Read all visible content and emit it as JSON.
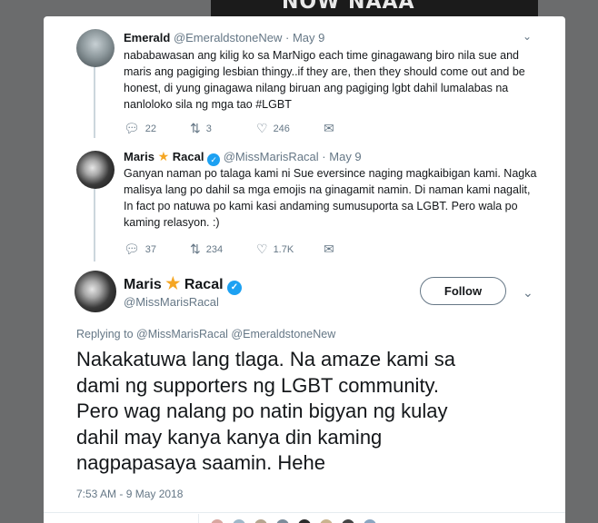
{
  "background_image": {
    "caption": "NOW NAAA"
  },
  "tweets": [
    {
      "name": "Emerald",
      "handle": "@EmeraldstoneNew",
      "separator": "·",
      "date": "May 9",
      "lines": [
        "nababawasan ang kilig ko sa MarNigo each time ginagawang biro nila sue and",
        "maris ang pagiging lesbian thingy..if they are, then they should come out and be",
        "honest, di yung ginagawa nilang biruan ang pagiging lgbt dahil lumalabas na",
        "nanloloko sila ng mga tao #LGBT"
      ],
      "actions": {
        "replies": "22",
        "retweets": "3",
        "likes": "246"
      }
    },
    {
      "name_first": "Maris",
      "name_last": "Racal",
      "handle": "@MissMarisRacal",
      "separator": "·",
      "date": "May 9",
      "lines": [
        "Ganyan naman po talaga kami ni Sue eversince naging magkaibigan kami. Nagka",
        "malisya lang po dahil sa mga emojis na ginagamit namin. Di naman kami nagalit,",
        "In fact po natuwa po kami kasi andaming sumusuporta sa LGBT. Pero wala po",
        "kaming relasyon. :)"
      ],
      "actions": {
        "replies": "37",
        "retweets": "234",
        "likes": "1.7K"
      }
    }
  ],
  "main_tweet": {
    "name_first": "Maris",
    "name_last": "Racal",
    "handle": "@MissMarisRacal",
    "follow_label": "Follow",
    "replying_label": "Replying to",
    "mention_1": "@MissMarisRacal",
    "mention_2": "@EmeraldstoneNew",
    "lines": [
      "Nakakatuwa lang tlaga. Na amaze kami sa",
      "dami ng supporters ng LGBT community.",
      "Pero wag nalang po natin bigyan ng kulay",
      "dahil may kanya kanya din kaming",
      "nagpapasaya saamin. Hehe"
    ],
    "timestamp": "7:53 AM - 9 May 2018"
  },
  "icons": {
    "reply": "reply-icon",
    "retweet": "retweet-icon",
    "like": "heart-icon",
    "dm": "envelope-icon",
    "verified": "verified-badge-icon",
    "caret": "chevron-down-icon"
  },
  "colors": {
    "accent": "#1da1f2",
    "star": "#f5a623",
    "muted": "#657786",
    "text": "#14171a"
  }
}
